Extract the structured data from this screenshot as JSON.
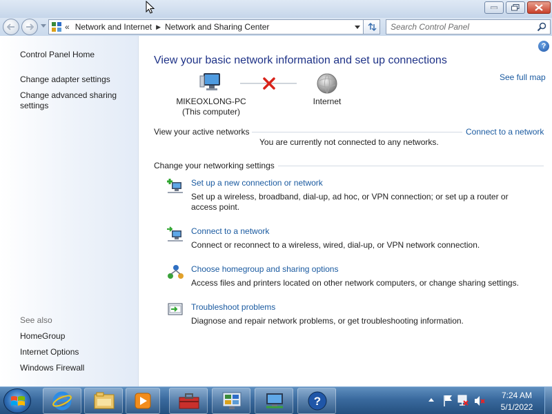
{
  "window": {
    "colors": {
      "title_gradient_top": "#dfe9f5",
      "close_red": "#c8402a"
    }
  },
  "address_bar": {
    "icon": "control-panel-icon",
    "leading_chevron": "«",
    "breadcrumbs": [
      "Network and Internet",
      "Network and Sharing Center"
    ],
    "separator": "▶"
  },
  "search": {
    "placeholder": "Search Control Panel",
    "value": ""
  },
  "left_pane": {
    "home": "Control Panel Home",
    "items": [
      "Change adapter settings",
      "Change advanced sharing settings"
    ],
    "see_also_label": "See also",
    "see_also": [
      "HomeGroup",
      "Internet Options",
      "Windows Firewall"
    ]
  },
  "main": {
    "title": "View your basic network information and set up connections",
    "see_full_map": "See full map",
    "computer_name": "MIKEOXLONG-PC",
    "computer_sub": "(This computer)",
    "internet_label": "Internet",
    "active_networks_heading": "View your active networks",
    "connect_link": "Connect to a network",
    "not_connected": "You are currently not connected to any networks.",
    "change_settings_heading": "Change your networking settings",
    "tasks": [
      {
        "link": "Set up a new connection or network",
        "desc": "Set up a wireless, broadband, dial-up, ad hoc, or VPN connection; or set up a router or access point."
      },
      {
        "link": "Connect to a network",
        "desc": "Connect or reconnect to a wireless, wired, dial-up, or VPN network connection."
      },
      {
        "link": "Choose homegroup and sharing options",
        "desc": "Access files and printers located on other network computers, or change sharing settings."
      },
      {
        "link": "Troubleshoot problems",
        "desc": "Diagnose and repair network problems, or get troubleshooting information."
      }
    ],
    "colors": {
      "title": "#1e3287",
      "link": "#1a5aa0"
    }
  },
  "taskbar": {
    "pinned": [
      "internet-explorer-icon",
      "windows-explorer-icon",
      "media-player-icon",
      "toolbox-icon",
      "control-panel-icon",
      "network-icon",
      "help-icon"
    ],
    "clock_time": "7:24 AM",
    "clock_date": "5/1/2022"
  }
}
